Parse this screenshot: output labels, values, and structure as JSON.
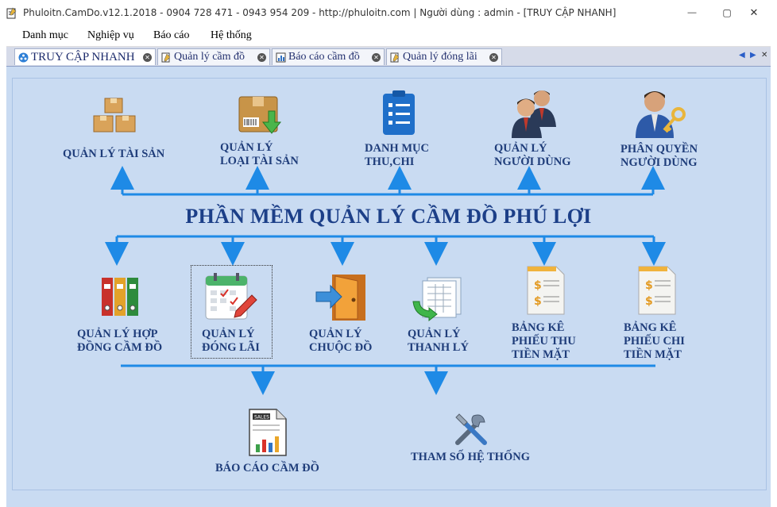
{
  "window": {
    "title": "Phuloitn.CamDo.v12.1.2018 - 0904 728 471 - 0943 954 209 - http://phuloitn.com | Người dùng : admin - [TRUY CẬP NHANH]",
    "minimize": "—",
    "maximize": "▢",
    "close": "✕"
  },
  "menu": [
    "Danh mục",
    "Nghiệp vụ",
    "Báo cáo",
    "Hệ thống"
  ],
  "tabs": [
    {
      "label": "TRUY CẬP NHANH",
      "icon": "quick-access-icon",
      "active": true
    },
    {
      "label": "Quản lý cầm đồ",
      "icon": "document-edit-icon",
      "active": false
    },
    {
      "label": "Báo cáo cầm đồ",
      "icon": "report-chart-icon",
      "active": false
    },
    {
      "label": "Quản lý đóng lãi",
      "icon": "document-edit-icon",
      "active": false
    }
  ],
  "tab_close": "✕",
  "tab_nav": {
    "prev": "◀",
    "next": "▶",
    "close": "✕"
  },
  "main_title": "PHẦN MỀM QUẢN LÝ CẦM ĐỒ PHÚ LỢI",
  "top_items": [
    {
      "lines": [
        "QUẢN LÝ TÀI SẢN"
      ],
      "icon": "boxes-icon"
    },
    {
      "lines": [
        "QUẢN LÝ",
        "LOẠI TÀI SẢN"
      ],
      "icon": "package-download-icon"
    },
    {
      "lines": [
        "DANH MỤC",
        "THU,CHI"
      ],
      "icon": "clipboard-list-icon"
    },
    {
      "lines": [
        "QUẢN LÝ",
        "NGƯỜI DÙNG"
      ],
      "icon": "users-icon"
    },
    {
      "lines": [
        "PHÂN QUYỀN",
        "NGƯỜI DÙNG"
      ],
      "icon": "user-key-icon"
    }
  ],
  "middle_items": [
    {
      "lines": [
        "QUẢN LÝ HỢP",
        "ĐỒNG CẦM ĐỒ"
      ],
      "icon": "binders-icon"
    },
    {
      "lines": [
        "QUẢN LÝ",
        "ĐÓNG LÃI"
      ],
      "icon": "calendar-edit-icon"
    },
    {
      "lines": [
        "QUẢN LÝ",
        "CHUỘC ĐỒ"
      ],
      "icon": "door-enter-icon"
    },
    {
      "lines": [
        "QUẢN LÝ",
        "THANH LÝ"
      ],
      "icon": "sheet-refresh-icon"
    },
    {
      "lines": [
        "BẢNG KÊ",
        "PHIẾU THU",
        "TIỀN MẶT"
      ],
      "icon": "receipt-money-icon"
    },
    {
      "lines": [
        "BẢNG KÊ",
        "PHIẾU CHI",
        "TIỀN MẶT"
      ],
      "icon": "receipt-money-icon"
    }
  ],
  "bottom_items": [
    {
      "lines": [
        "BÁO CÁO CẦM ĐỒ"
      ],
      "icon": "sales-report-icon",
      "badge": "SALES"
    },
    {
      "lines": [
        "THAM SỐ HỆ THỐNG"
      ],
      "icon": "tools-icon"
    }
  ],
  "colors": {
    "accent": "#1e8ae6",
    "label": "#1f3d7a",
    "panel": "#c9dbf2"
  }
}
